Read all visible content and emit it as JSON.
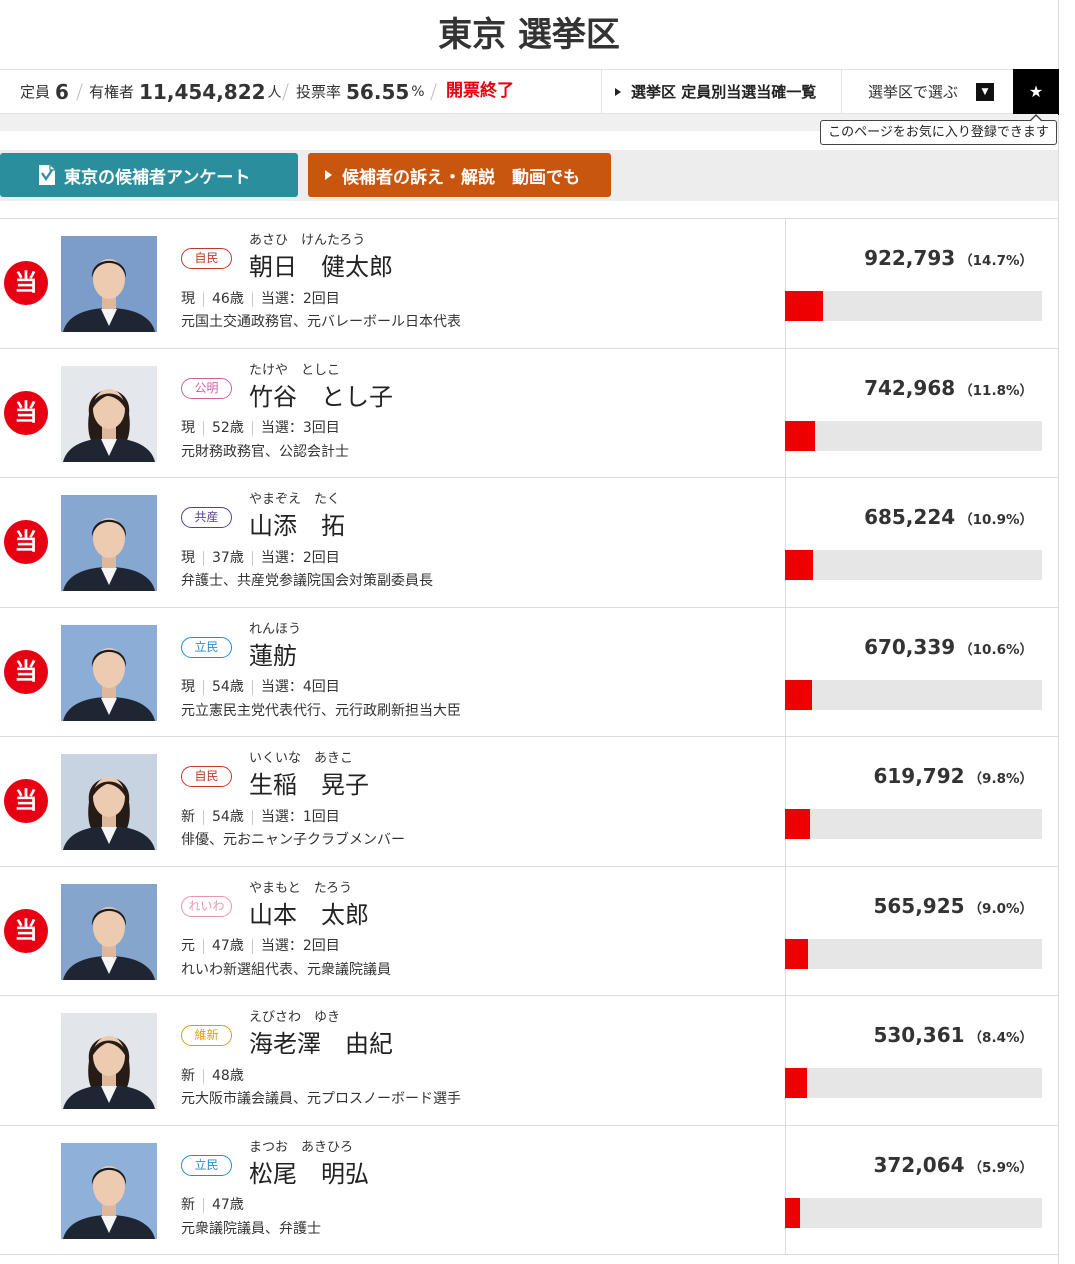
{
  "page": {
    "title": "東京 選挙区"
  },
  "summary": {
    "seats_label": "定員",
    "seats_value": "6",
    "voters_label": "有権者",
    "voters_value": "11,454,822",
    "voters_unit": "人",
    "turnout_label": "投票率",
    "turnout_value": "56.55",
    "turnout_unit": "%",
    "status": "開票終了"
  },
  "nav": {
    "winners_link": "選挙区 定員別当選当確一覧",
    "district_select": "選挙区で選ぶ",
    "dropdown_icon": "▼",
    "favorite_icon": "★",
    "favorite_tooltip": "このページをお気に入り登録できます"
  },
  "actions": {
    "survey_button": "東京の候補者アンケート",
    "video_button": "候補者の訴え・解説　動画でも"
  },
  "elected_mark": "当",
  "colors": {
    "elected": "#e60012",
    "status": "#e60012",
    "bar_fill": "#ee0000",
    "bar_track": "#e6e6e6",
    "survey_button": "#2b8e9c",
    "video_button": "#c9560f",
    "favorite_button": "#000000"
  },
  "candidates": [
    {
      "furigana": "あさひ　けんたろう",
      "name": "朝日　健太郎",
      "party": "自民",
      "party_color": "#c0392b",
      "profile": [
        "現",
        "46歳",
        "当選：2回目"
      ],
      "career": "元国土交通政務官、元バレーボール日本代表",
      "votes": "922,793",
      "share": "（14.7%）",
      "elected": true,
      "photo_bg": "#7c9dc9",
      "portrait_icon": "portrait-short-hair-icon"
    },
    {
      "furigana": "たけや　としこ",
      "name": "竹谷　とし子",
      "party": "公明",
      "party_color": "#d35fa6",
      "profile": [
        "現",
        "52歳",
        "当選：3回目"
      ],
      "career": "元財務政務官、公認会計士",
      "votes": "742,968",
      "share": "（11.8%）",
      "elected": true,
      "photo_bg": "#e4e7ec",
      "portrait_icon": "portrait-long-hair-icon"
    },
    {
      "furigana": "やまぞえ　たく",
      "name": "山添　拓",
      "party": "共産",
      "party_color": "#5b3f95",
      "profile": [
        "現",
        "37歳",
        "当選：2回目"
      ],
      "career": "弁護士、共産党参議院国会対策副委員長",
      "votes": "685,224",
      "share": "（10.9%）",
      "elected": true,
      "photo_bg": "#86a7d0",
      "portrait_icon": "portrait-short-hair-icon"
    },
    {
      "furigana": "れんほう",
      "name": "蓮舫",
      "party": "立民",
      "party_color": "#1f8fd3",
      "profile": [
        "現",
        "54歳",
        "当選：4回目"
      ],
      "career": "元立憲民主党代表代行、元行政刷新担当大臣",
      "votes": "670,339",
      "share": "（10.6%）",
      "elected": true,
      "photo_bg": "#8cadd6",
      "portrait_icon": "portrait-short-hair-icon"
    },
    {
      "furigana": "いくいな　あきこ",
      "name": "生稲　晃子",
      "party": "自民",
      "party_color": "#c0392b",
      "profile": [
        "新",
        "54歳",
        "当選：1回目"
      ],
      "career": "俳優、元おニャン子クラブメンバー",
      "votes": "619,792",
      "share": "（9.8%）",
      "elected": true,
      "photo_bg": "#c8d3e2",
      "portrait_icon": "portrait-long-hair-icon"
    },
    {
      "furigana": "やまもと　たろう",
      "name": "山本　太郎",
      "party": "れいわ",
      "party_color": "#e896b4",
      "profile": [
        "元",
        "47歳",
        "当選：2回目"
      ],
      "career": "れいわ新選組代表、元衆議院議員",
      "votes": "565,925",
      "share": "（9.0%）",
      "elected": true,
      "photo_bg": "#86a5cd",
      "portrait_icon": "portrait-short-hair-icon"
    },
    {
      "furigana": "えびさわ　ゆき",
      "name": "海老澤　由紀",
      "party": "維新",
      "party_color": "#e39a18",
      "profile": [
        "新",
        "48歳"
      ],
      "career": "元大阪市議会議員、元プロスノーボード選手",
      "votes": "530,361",
      "share": "（8.4%）",
      "elected": false,
      "photo_bg": "#e2e5ea",
      "portrait_icon": "portrait-long-hair-icon"
    },
    {
      "furigana": "まつお　あきひろ",
      "name": "松尾　明弘",
      "party": "立民",
      "party_color": "#1f8fd3",
      "profile": [
        "新",
        "47歳"
      ],
      "career": "元衆議院議員、弁護士",
      "votes": "372,064",
      "share": "（5.9%）",
      "elected": false,
      "photo_bg": "#8fb0d8",
      "portrait_icon": "portrait-short-hair-icon"
    }
  ]
}
